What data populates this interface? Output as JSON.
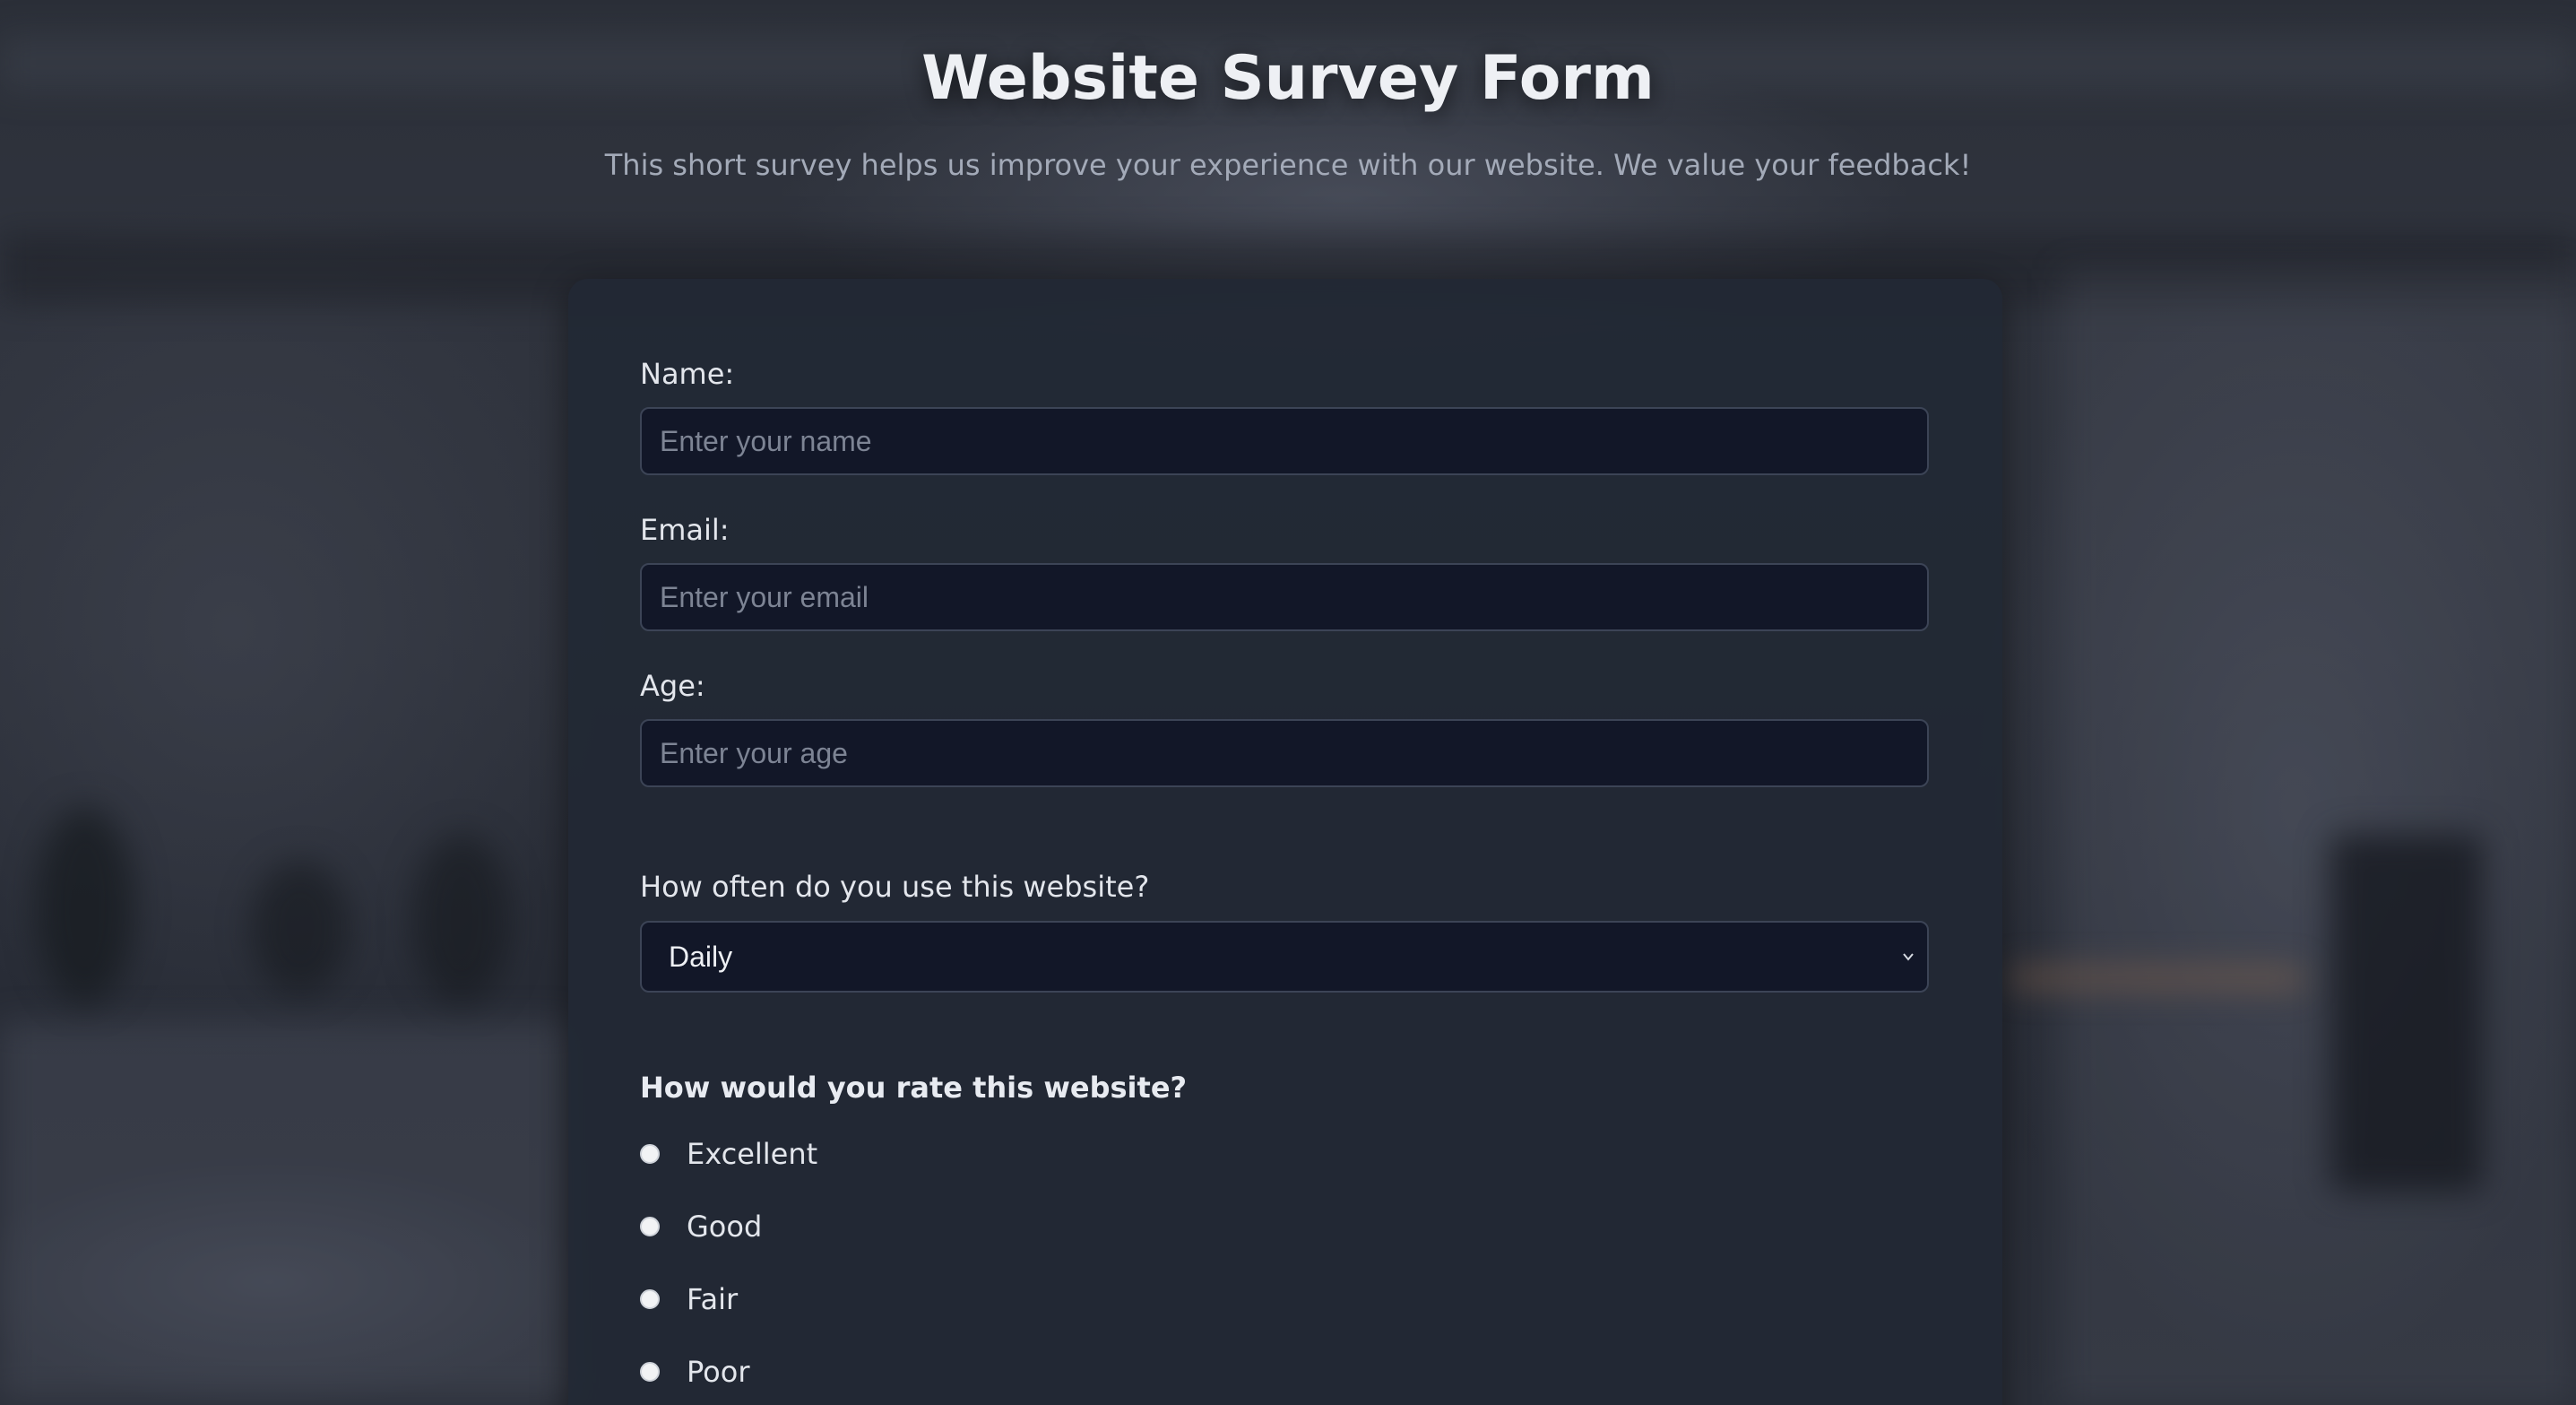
{
  "header": {
    "title": "Website Survey Form",
    "subtitle": "This short survey helps us improve your experience with our website. We value your feedback!"
  },
  "form": {
    "name": {
      "label": "Name:",
      "placeholder": "Enter your name",
      "value": ""
    },
    "email": {
      "label": "Email:",
      "placeholder": "Enter your email",
      "value": ""
    },
    "age": {
      "label": "Age:",
      "placeholder": "Enter your age",
      "value": ""
    },
    "frequency": {
      "label": "How often do you use this website?",
      "selected": "Daily",
      "icon": "chevron-down-icon"
    },
    "rating": {
      "question": "How would you rate this website?",
      "options": [
        "Excellent",
        "Good",
        "Fair",
        "Poor"
      ],
      "selected": null
    }
  },
  "colors": {
    "card_background": "#222834",
    "input_background": "#121728",
    "input_border": "#3c4456",
    "title_text": "#eef0f4",
    "subtitle_text": "#a3aab8"
  }
}
